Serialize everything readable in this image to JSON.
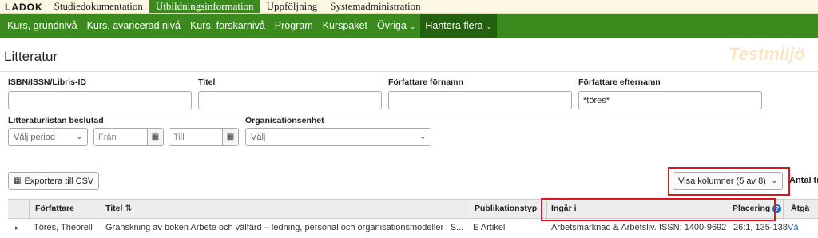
{
  "top_nav": {
    "logo": "LADOK",
    "items": [
      {
        "label": "Studiedokumentation"
      },
      {
        "label": "Utbildningsinformation"
      },
      {
        "label": "Uppföljning"
      },
      {
        "label": "Systemadministration"
      }
    ],
    "active_index": 1
  },
  "sub_nav": {
    "items": [
      {
        "label": "Kurs, grundnivå"
      },
      {
        "label": "Kurs, avancerad nivå"
      },
      {
        "label": "Kurs, forskarnivå"
      },
      {
        "label": "Program"
      },
      {
        "label": "Kurspaket"
      },
      {
        "label": "Övriga"
      },
      {
        "label": "Hantera flera"
      }
    ],
    "active_index": 6
  },
  "page": {
    "title": "Litteratur",
    "watermark": "Testmiljö"
  },
  "filters": {
    "isbn_label": "ISBN/ISSN/Libris-ID",
    "isbn_value": "",
    "titel_label": "Titel",
    "titel_value": "",
    "fornamn_label": "Författare förnamn",
    "fornamn_value": "",
    "efternamn_label": "Författare efternamn",
    "efternamn_value": "*töres*",
    "beslutad_label": "Litteraturlistan beslutad",
    "period_placeholder": "Välj period",
    "fran_placeholder": "Från",
    "till_placeholder": "Till",
    "org_label": "Organisationsenhet",
    "org_placeholder": "Välj"
  },
  "toolbar": {
    "export_label": "Exportera till CSV",
    "visa_kolumner_label": "Visa kolumner (5 av 8)",
    "antal_label": "Antal tr"
  },
  "table": {
    "headers": {
      "forfattare": "Författare",
      "titel": "Titel",
      "publikationstyp": "Publikationstyp",
      "ingar_i": "Ingår i",
      "placering": "Placering",
      "atgard": "Åtgä"
    },
    "rows": [
      {
        "forfattare": "Töres, Theorell",
        "titel": "Granskning av boken Arbete och välfärd – ledning, personal och organisationsmodeller i S...",
        "publikationstyp": "E Artikel",
        "ingar_i": "Arbetsmarknad & Arbetsliv. ISSN: 1400-9692",
        "placering": "26:1, 135-138",
        "atgard": "Vä"
      }
    ]
  },
  "colors": {
    "nav_green": "#3b8a1e",
    "nav_active": "#24600f",
    "highlight_red": "#e0141e",
    "link_blue": "#1f6bb8"
  }
}
